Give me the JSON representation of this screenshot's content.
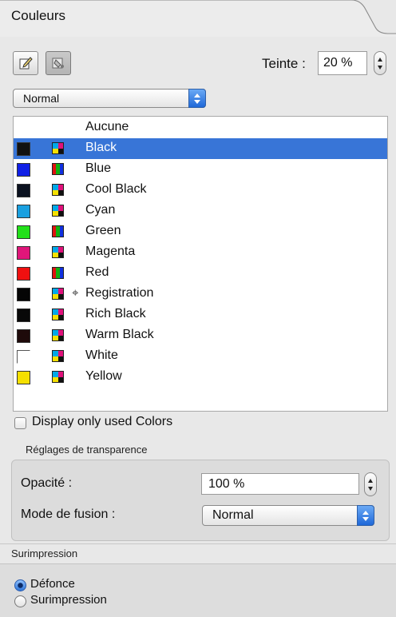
{
  "panel": {
    "title": "Couleurs"
  },
  "tools": {
    "teinte_label": "Teinte :",
    "teinte_value": "20 %"
  },
  "blend_select": {
    "value": "Normal"
  },
  "colors": [
    {
      "name": "Aucune",
      "swatch": "none",
      "type": "none",
      "selected": false,
      "reg": false
    },
    {
      "name": "Black",
      "swatch": "#111111",
      "type": "cmyk",
      "selected": true,
      "reg": false
    },
    {
      "name": "Blue",
      "swatch": "#1020e6",
      "type": "rgb",
      "selected": false,
      "reg": false
    },
    {
      "name": "Cool Black",
      "swatch": "#0b1220",
      "type": "cmyk",
      "selected": false,
      "reg": false
    },
    {
      "name": "Cyan",
      "swatch": "#1aa0e0",
      "type": "cmyk",
      "selected": false,
      "reg": false
    },
    {
      "name": "Green",
      "swatch": "#22e01a",
      "type": "rgb",
      "selected": false,
      "reg": false
    },
    {
      "name": "Magenta",
      "swatch": "#e0167a",
      "type": "cmyk",
      "selected": false,
      "reg": false
    },
    {
      "name": "Red",
      "swatch": "#f01010",
      "type": "rgb",
      "selected": false,
      "reg": false
    },
    {
      "name": "Registration",
      "swatch": "#050505",
      "type": "cmyk",
      "selected": false,
      "reg": true
    },
    {
      "name": "Rich Black",
      "swatch": "#080808",
      "type": "cmyk",
      "selected": false,
      "reg": false
    },
    {
      "name": "Warm Black",
      "swatch": "#1e0a0a",
      "type": "cmyk",
      "selected": false,
      "reg": false
    },
    {
      "name": "White",
      "swatch": "#ffffff",
      "type": "cmyk",
      "selected": false,
      "reg": false
    },
    {
      "name": "Yellow",
      "swatch": "#f5e000",
      "type": "cmyk",
      "selected": false,
      "reg": false
    }
  ],
  "display_used": {
    "label": "Display only used Colors",
    "checked": false
  },
  "transparency": {
    "title": "Réglages de transparence",
    "opacity_label": "Opacité :",
    "opacity_value": "100 %",
    "blend_label": "Mode de fusion :",
    "blend_value": "Normal"
  },
  "overprint": {
    "title": "Surimpression",
    "options": [
      "Défonce",
      "Surimpression"
    ],
    "selected": "Défonce"
  },
  "icons": {
    "registration": "registration-mark-icon",
    "cmyk": "cmyk-color-icon",
    "rgb": "rgb-color-icon"
  },
  "selection_color": "#3875d7"
}
